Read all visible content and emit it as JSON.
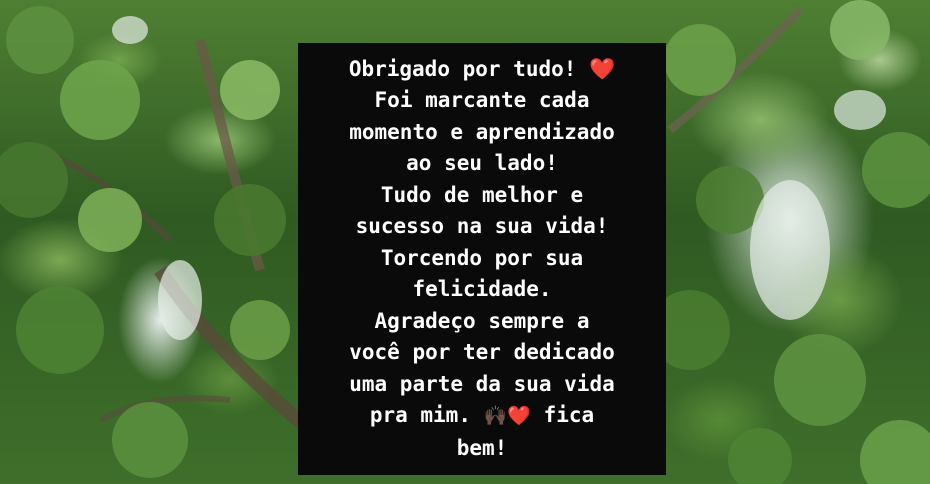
{
  "message": {
    "lines": [
      {
        "text": "Obrigado por tudo! ",
        "emoji": "❤️"
      },
      {
        "text": "Foi marcante cada"
      },
      {
        "text": "momento e aprendizado"
      },
      {
        "text": "ao seu lado!"
      },
      {
        "text": "Tudo de melhor e"
      },
      {
        "text": "sucesso na sua vida!"
      },
      {
        "text": "Torcendo por sua"
      },
      {
        "text": "felicidade."
      },
      {
        "text": "Agradeço sempre a"
      },
      {
        "text": "você por ter dedicado"
      },
      {
        "text": "uma parte da sua vida"
      },
      {
        "text": "pra mim. ",
        "emoji": "🙌🏿❤️",
        "after": " fica"
      },
      {
        "text": "bem!"
      }
    ]
  },
  "colors": {
    "card_background": "#0a0a0a",
    "text": "#ffffff",
    "heart": "#e8202f"
  },
  "background": {
    "description_icon": "tree-canopy-photo"
  }
}
